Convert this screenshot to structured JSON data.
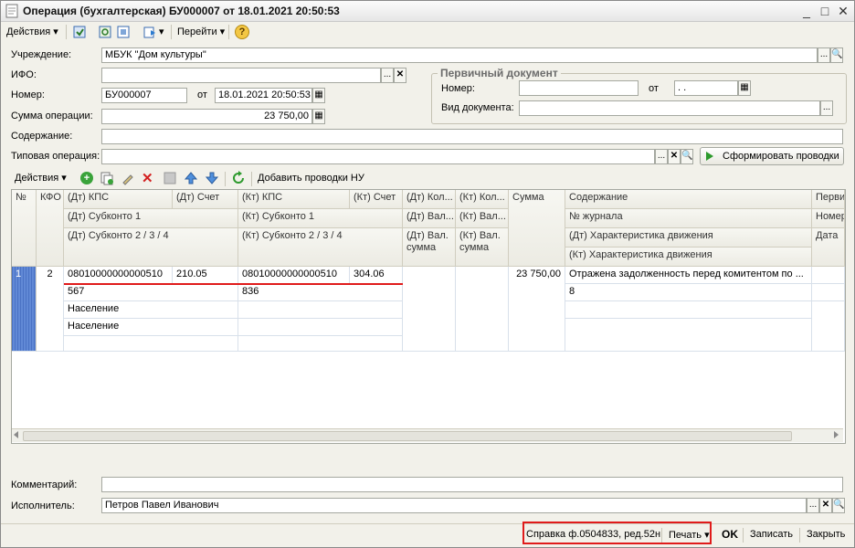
{
  "window": {
    "title": "Операция (бухгалтерская) БУ000007 от 18.01.2021 20:50:53",
    "minimize_glyph": "_",
    "maximize_glyph": "□",
    "close_glyph": "✕"
  },
  "toolbar": {
    "actions_label": "Действия",
    "goto_label": "Перейти",
    "help_glyph": "?"
  },
  "form": {
    "institution_label": "Учреждение:",
    "institution_value": "МБУК \"Дом культуры\"",
    "ifo_label": "ИФО:",
    "ifo_value": "",
    "number_label": "Номер:",
    "number_value": "БУ000007",
    "date_from_label": "от",
    "date_value": "18.01.2021 20:50:53",
    "amount_label": "Сумма операции:",
    "amount_value": "23 750,00",
    "content_label": "Содержание:",
    "content_value": "",
    "typical_label": "Типовая операция:",
    "typical_value": "",
    "generate_button": "Сформировать проводки"
  },
  "primary_doc": {
    "title": "Первичный документ",
    "number_label": "Номер:",
    "number_value": "",
    "date_from_label": "от",
    "date_value": " .  .",
    "doc_type_label": "Вид документа:",
    "doc_type_value": ""
  },
  "grid_toolbar": {
    "actions_label": "Действия",
    "add_nu_label": "Добавить проводки НУ"
  },
  "grid": {
    "headers": {
      "num": "№",
      "kfo": "КФО",
      "dt_kps": "(Дт) КПС",
      "dt_account": "(Дт) Счет",
      "dt_subkonto1": "(Дт) Субконто 1",
      "dt_subkonto234": "(Дт) Субконто 2 / 3 / 4",
      "kt_kps": "(Кт) КПС",
      "kt_account": "(Кт) Счет",
      "kt_subkonto1": "(Кт) Субконто 1",
      "kt_subkonto234": "(Кт) Субконто 2 / 3 / 4",
      "dt_qty": "(Дт) Кол...",
      "dt_cur": "(Дт) Вал...",
      "dt_cur_sum": "(Дт) Вал. сумма",
      "kt_qty": "(Кт) Кол...",
      "kt_cur": "(Кт) Вал...",
      "kt_cur_sum": "(Кт) Вал. сумма",
      "sum": "Сумма",
      "content": "Содержание",
      "journal_no": "№ журнала",
      "dt_movement": "(Дт) Характеристика движения",
      "kt_movement": "(Кт) Характеристика движения",
      "primary": "Перви",
      "number": "Номер",
      "date": "Дата"
    },
    "row": {
      "num": "1",
      "kfo": "2",
      "dt_kps": "08010000000000510",
      "dt_account": "210.05",
      "dt_subkonto1": "567",
      "dt_subkonto2": "Население",
      "dt_subkonto3": "Население",
      "kt_kps": "08010000000000510",
      "kt_account": "304.06",
      "kt_subkonto1": "836",
      "sum": "23 750,00",
      "content": "Отражена задолженность перед комитентом по ...",
      "journal_no": "8"
    }
  },
  "bottom": {
    "comment_label": "Комментарий:",
    "comment_value": "",
    "executor_label": "Исполнитель:",
    "executor_value": "Петров Павел Иванович"
  },
  "status_bar": {
    "spravka_label": "Справка ф.0504833, ред.52н",
    "print_label": "Печать",
    "ok_label": "OK",
    "save_label": "Записать",
    "close_label": "Закрыть"
  },
  "colors": {
    "highlight_red": "#e01b1b",
    "selected_row_marker": "#4a72c4"
  }
}
